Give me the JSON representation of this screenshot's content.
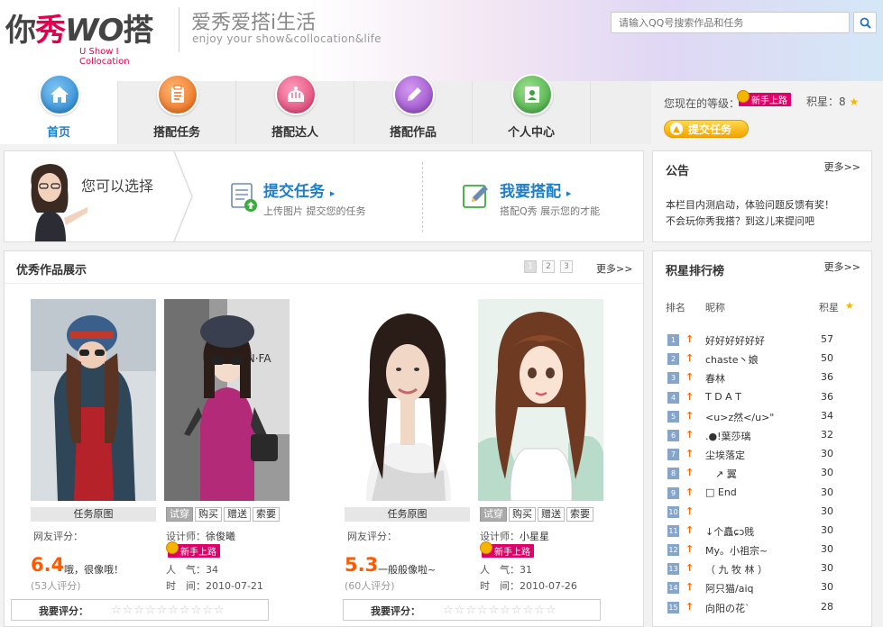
{
  "header": {
    "logo_text": "你秀WO搭",
    "logo_sub": "U Show I Collocation",
    "slogan": "爱秀爱搭i生活",
    "slogan_en": "enjoy your show&collocation&life",
    "search_placeholder": "请输入QQ号搜索作品和任务"
  },
  "nav": [
    {
      "label": "首页",
      "icon": "home-icon",
      "color": "#2d90d8",
      "active": true
    },
    {
      "label": "搭配任务",
      "icon": "clipboard-icon",
      "color": "#f07a20",
      "active": false
    },
    {
      "label": "搭配达人",
      "icon": "crown-icon",
      "color": "#e04a78",
      "active": false
    },
    {
      "label": "搭配作品",
      "icon": "pencil-icon",
      "color": "#a25acf",
      "active": false
    },
    {
      "label": "个人中心",
      "icon": "id-card-icon",
      "color": "#4ab24a",
      "active": false
    }
  ],
  "level": {
    "label": "您现在的等级：",
    "badge": "新手上路",
    "points_label": "积星：8",
    "submit_button": "提交任务"
  },
  "banner": {
    "choose": "您可以选择",
    "option1_title": "提交任务",
    "option1_sub": "上传图片  提交您的任务",
    "option2_title": "我要搭配",
    "option2_sub": "搭配Q秀  展示您的才能"
  },
  "notice": {
    "title": "公告",
    "more": "更多>>",
    "line1": "本栏目内测启动，体验问题反馈有奖！",
    "line2": "不会玩你秀我搭？到这儿来提问吧"
  },
  "works": {
    "title": "优秀作品展示",
    "pages": [
      "1",
      "2",
      "3"
    ],
    "more": "更多>>",
    "cards": [
      {
        "photo_label": "任务原图",
        "actions": [
          "试穿",
          "购买",
          "赠送",
          "索要"
        ],
        "rating_label": "网友评分：",
        "score": "6.4",
        "score_note": "哦，很像哦！",
        "score_count": "(53人评分)",
        "designer_label": "设计师：",
        "designer": "徐俊曦",
        "badge": "新手上路",
        "popularity": "人　气：34",
        "time": "时　间：2010-07-21",
        "rate_label": "我要评分：",
        "stars": "☆☆☆☆☆☆☆☆☆☆"
      },
      {
        "photo_label": "任务原图",
        "actions": [
          "试穿",
          "购买",
          "赠送",
          "索要"
        ],
        "rating_label": "网友评分：",
        "score": "5.3",
        "score_note": "一般般像啦~",
        "score_count": "(60人评分)",
        "designer_label": "设计师：",
        "designer": "小星星",
        "badge": "新手上路",
        "popularity": "人　气：31",
        "time": "时　间：2010-07-26",
        "rate_label": "我要评分：",
        "stars": "☆☆☆☆☆☆☆☆☆☆"
      }
    ]
  },
  "ranking": {
    "title": "积星排行榜",
    "more": "更多>>",
    "col_rank": "排名",
    "col_name": "昵称",
    "col_points": "积星",
    "rows": [
      {
        "rank": "1",
        "name": "好好好好好好",
        "points": "57"
      },
      {
        "rank": "2",
        "name": "chaste丶娘",
        "points": "50"
      },
      {
        "rank": "3",
        "name": "春林",
        "points": "36"
      },
      {
        "rank": "4",
        "name": "T D A T",
        "points": "36"
      },
      {
        "rank": "5",
        "name": "<u>z然</u>\"",
        "points": "34"
      },
      {
        "rank": "6",
        "name": ".●!葉莎璃",
        "points": "32"
      },
      {
        "rank": "7",
        "name": "尘埃落定",
        "points": "30"
      },
      {
        "rank": "8",
        "name": "　↗ 翼",
        "points": "30"
      },
      {
        "rank": "9",
        "name": "□ End",
        "points": "30"
      },
      {
        "rank": "10",
        "name": "",
        "points": "30"
      },
      {
        "rank": "11",
        "name": "↓个矗ɕɔ贱",
        "points": "30"
      },
      {
        "rank": "12",
        "name": "My。小祖宗~",
        "points": "30"
      },
      {
        "rank": "13",
        "name": "（ 九 牧 林 ）",
        "points": "30"
      },
      {
        "rank": "14",
        "name": "阿只猫/aiq",
        "points": "30"
      },
      {
        "rank": "15",
        "name": " 向阳の花`",
        "points": "28"
      }
    ]
  }
}
